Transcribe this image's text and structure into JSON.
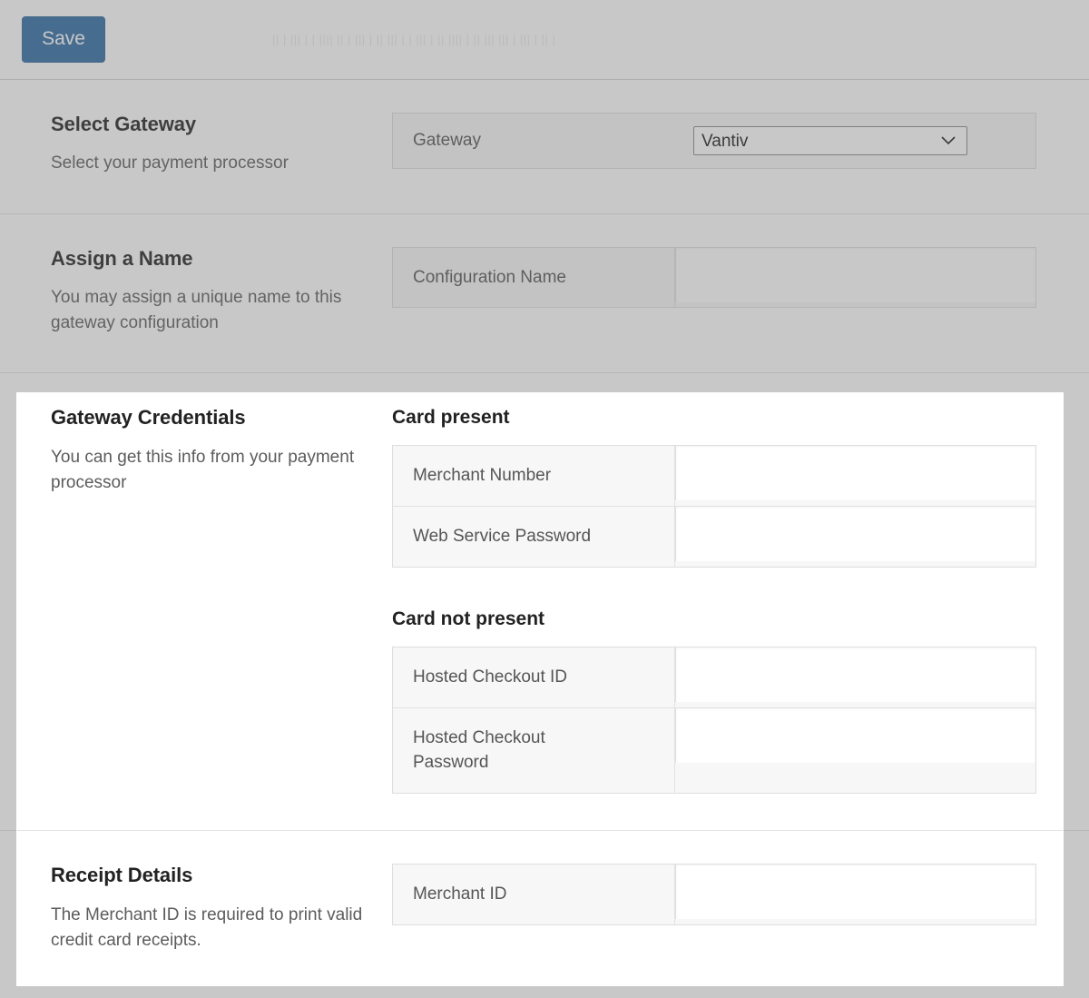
{
  "toolbar": {
    "save_label": "Save",
    "ghost_text": "|| | ||| | | |||| || | ||| |  || ||| |  | ||| | || |||| | ||  ||| ||| |  ||| | || |"
  },
  "colors": {
    "accent": "#2e6da4",
    "page_background": "#ffffff",
    "dim_overlay": "rgba(110,110,110,0.38)",
    "field_background": "#f7f7f7",
    "input_background": "#ffffff",
    "border": "#dedede",
    "title_text": "#222222",
    "body_text": "#5c5c5c",
    "label_text": "#555555"
  },
  "sections": [
    {
      "id": "select-gateway",
      "title": "Select Gateway",
      "subtitle": "Select your payment processor",
      "field": {
        "label": "Gateway",
        "selected": "Vantiv",
        "options": [
          "Vantiv"
        ],
        "chevron_icon": "chevron-down-icon"
      }
    },
    {
      "id": "assign-a-name",
      "title": "Assign a Name",
      "subtitle": "You may assign a unique name to this gateway configuration",
      "field": {
        "label": "Configuration Name",
        "value": "",
        "placeholder": ""
      }
    },
    {
      "id": "gateway-credentials",
      "title": "Gateway Credentials",
      "subtitle": "You can get this info from your payment processor",
      "groups": [
        {
          "heading": "Card present",
          "fields": [
            {
              "label": "Merchant Number",
              "value": "",
              "placeholder": ""
            },
            {
              "label": "Web Service Password",
              "value": "",
              "placeholder": ""
            }
          ]
        },
        {
          "heading": "Card not present",
          "fields": [
            {
              "label": "Hosted Checkout ID",
              "value": "",
              "placeholder": ""
            },
            {
              "label": "Hosted Checkout Password",
              "value": "",
              "placeholder": ""
            }
          ]
        }
      ]
    },
    {
      "id": "receipt-details",
      "title": "Receipt Details",
      "subtitle": "The Merchant ID is required to print valid credit card receipts.",
      "fields": [
        {
          "label": "Merchant ID",
          "value": "",
          "placeholder": ""
        }
      ]
    }
  ]
}
